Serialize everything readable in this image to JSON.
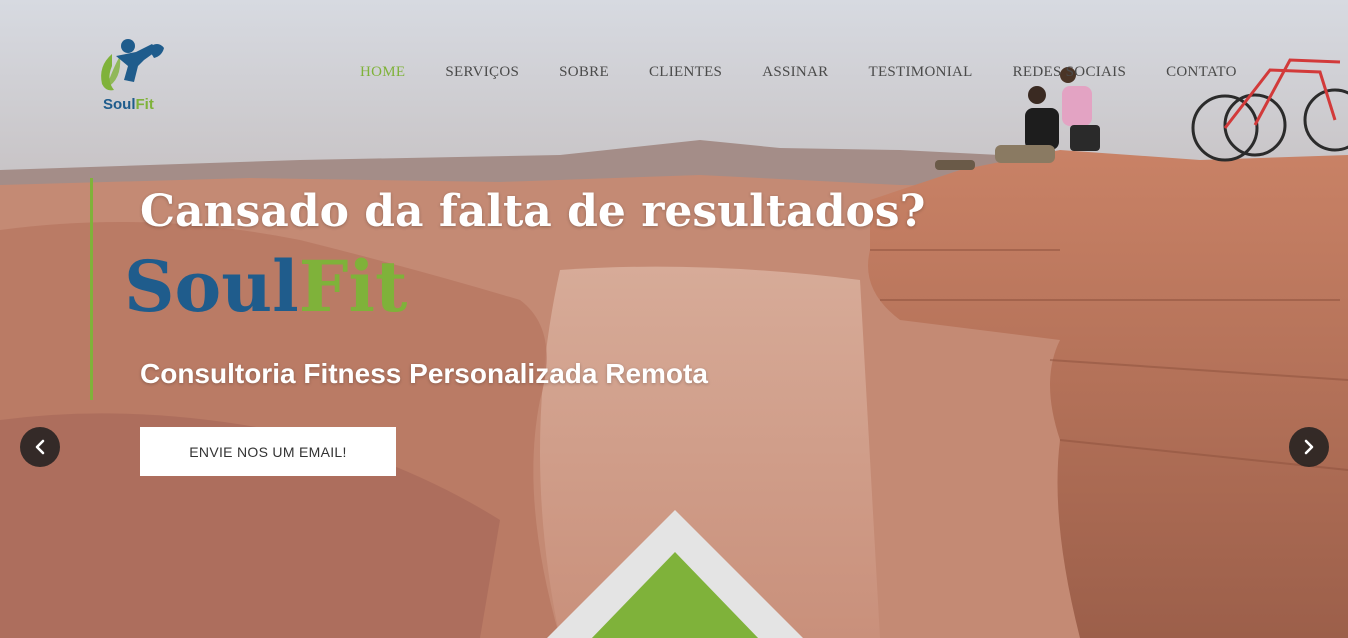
{
  "colors": {
    "accent": "#7fb23a",
    "brand_blue": "#1f5c8c",
    "nav_text": "#4a4a4a"
  },
  "logo": {
    "soul": "Soul",
    "fit": "Fit"
  },
  "nav": {
    "items": [
      {
        "label": "HOME",
        "active": true
      },
      {
        "label": "SERVIÇOS"
      },
      {
        "label": "SOBRE"
      },
      {
        "label": "CLIENTES"
      },
      {
        "label": "ASSINAR"
      },
      {
        "label": "TESTIMONIAL"
      },
      {
        "label": "REDES SOCIAIS"
      },
      {
        "label": "CONTATO"
      }
    ]
  },
  "hero": {
    "headline": "Cansado da falta de resultados?",
    "brand_soul": "Soul",
    "brand_fit": "Fit",
    "subtitle": "Consultoria Fitness Personalizada Remota",
    "cta_label": "ENVIE NOS UM EMAIL!"
  },
  "carousel": {
    "prev_icon": "chevron-left-icon",
    "next_icon": "chevron-right-icon"
  }
}
